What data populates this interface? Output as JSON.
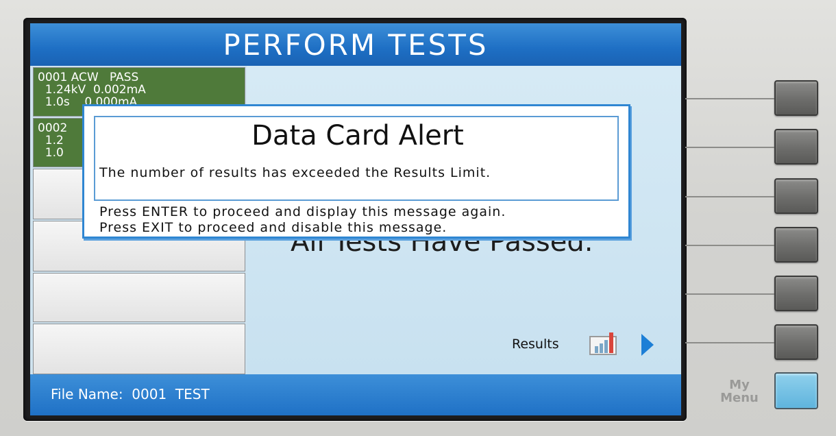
{
  "screen": {
    "title": "PERFORM TESTS",
    "tests": [
      {
        "line1": "0001 ACW   PASS",
        "line2": "  1.24kV  0.002mA",
        "line3": "  1.0s    0.000mA"
      },
      {
        "line1": "0002",
        "line2": "  1.2",
        "line3": "  1.0"
      }
    ],
    "main_message": "All Tests Have Passed.",
    "results_label": "Results",
    "results_icon": "bar-chart-icon",
    "results_arrow_icon": "right-arrow-icon",
    "file_name_label": "File Name:",
    "file_name_value": "0001  TEST"
  },
  "alert": {
    "title": "Data Card Alert",
    "message": "The number of results has exceeded the Results Limit.",
    "enter_instruction": "Press ENTER to proceed and display this message again.",
    "exit_instruction": "Press EXIT to proceed and disable this message."
  },
  "panel": {
    "my_menu_line1": "My",
    "my_menu_line2": "Menu"
  },
  "colors": {
    "title_bar": "#1e6fc4",
    "pass_cell": "#4f7a3a",
    "my_menu_key": "#5fb4dd"
  }
}
